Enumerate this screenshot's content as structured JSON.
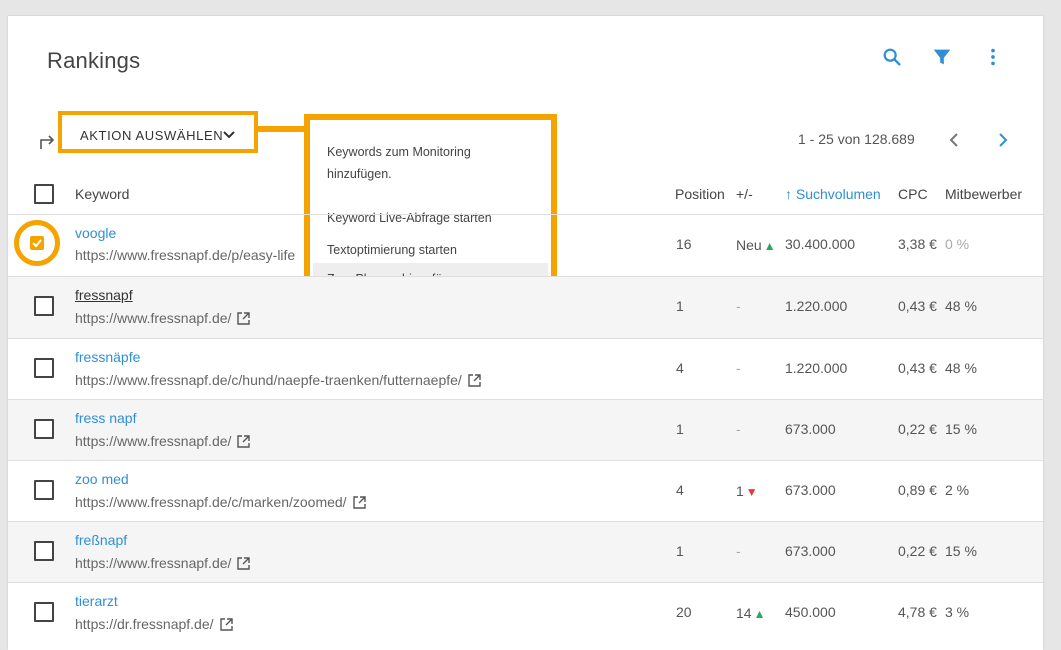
{
  "header": {
    "title": "Rankings",
    "icons": [
      "search-icon",
      "filter-icon",
      "more-vert-icon"
    ]
  },
  "action": {
    "label": "AKTION AUSWÄHLEN"
  },
  "menu": {
    "items": [
      {
        "line1": "Keywords zum Monitoring",
        "line2": "hinzufügen."
      },
      {
        "line1": "Keyword Live-Abfrage starten"
      },
      {
        "line1": "Textoptimierung starten"
      },
      {
        "line1": "Zum Planner hinzufügen"
      }
    ]
  },
  "pagination": {
    "text": "1 - 25 von 128.689"
  },
  "columns": {
    "keyword": "Keyword",
    "position": "Position",
    "change": "+/-",
    "volume": "Suchvolumen",
    "cpc": "CPC",
    "competition": "Mitbewerber"
  },
  "rows": [
    {
      "keyword": "voogle",
      "url": "https://www.fressnapf.de/p/easy-life",
      "position": "16",
      "change": "Neu",
      "trend": "up",
      "volume": "30.400.000",
      "cpc": "3,38 €",
      "competition": "0 %",
      "checked": true
    },
    {
      "keyword": "fressnapf",
      "url": "https://www.fressnapf.de/",
      "position": "1",
      "change": "-",
      "trend": "",
      "volume": "1.220.000",
      "cpc": "0,43 €",
      "competition": "48 %"
    },
    {
      "keyword": "fressnäpfe",
      "url": "https://www.fressnapf.de/c/hund/naepfe-traenken/futternaepfe/",
      "position": "4",
      "change": "-",
      "trend": "",
      "volume": "1.220.000",
      "cpc": "0,43 €",
      "competition": "48 %"
    },
    {
      "keyword": "fress napf",
      "url": "https://www.fressnapf.de/",
      "position": "1",
      "change": "-",
      "trend": "",
      "volume": "673.000",
      "cpc": "0,22 €",
      "competition": "15 %"
    },
    {
      "keyword": "zoo med",
      "url": "https://www.fressnapf.de/c/marken/zoomed/",
      "position": "4",
      "change": "1",
      "trend": "down",
      "volume": "673.000",
      "cpc": "0,89 €",
      "competition": "2 %"
    },
    {
      "keyword": "freßnapf",
      "url": "https://www.fressnapf.de/",
      "position": "1",
      "change": "-",
      "trend": "",
      "volume": "673.000",
      "cpc": "0,22 €",
      "competition": "15 %"
    },
    {
      "keyword": "tierarzt",
      "url": "https://dr.fressnapf.de/",
      "position": "20",
      "change": "14",
      "trend": "up",
      "volume": "450.000",
      "cpc": "4,78 €",
      "competition": "3 %"
    }
  ],
  "colors": {
    "accent": "#f5a300",
    "link": "#2f8fd6",
    "up": "#27a85a",
    "down": "#e53935"
  }
}
